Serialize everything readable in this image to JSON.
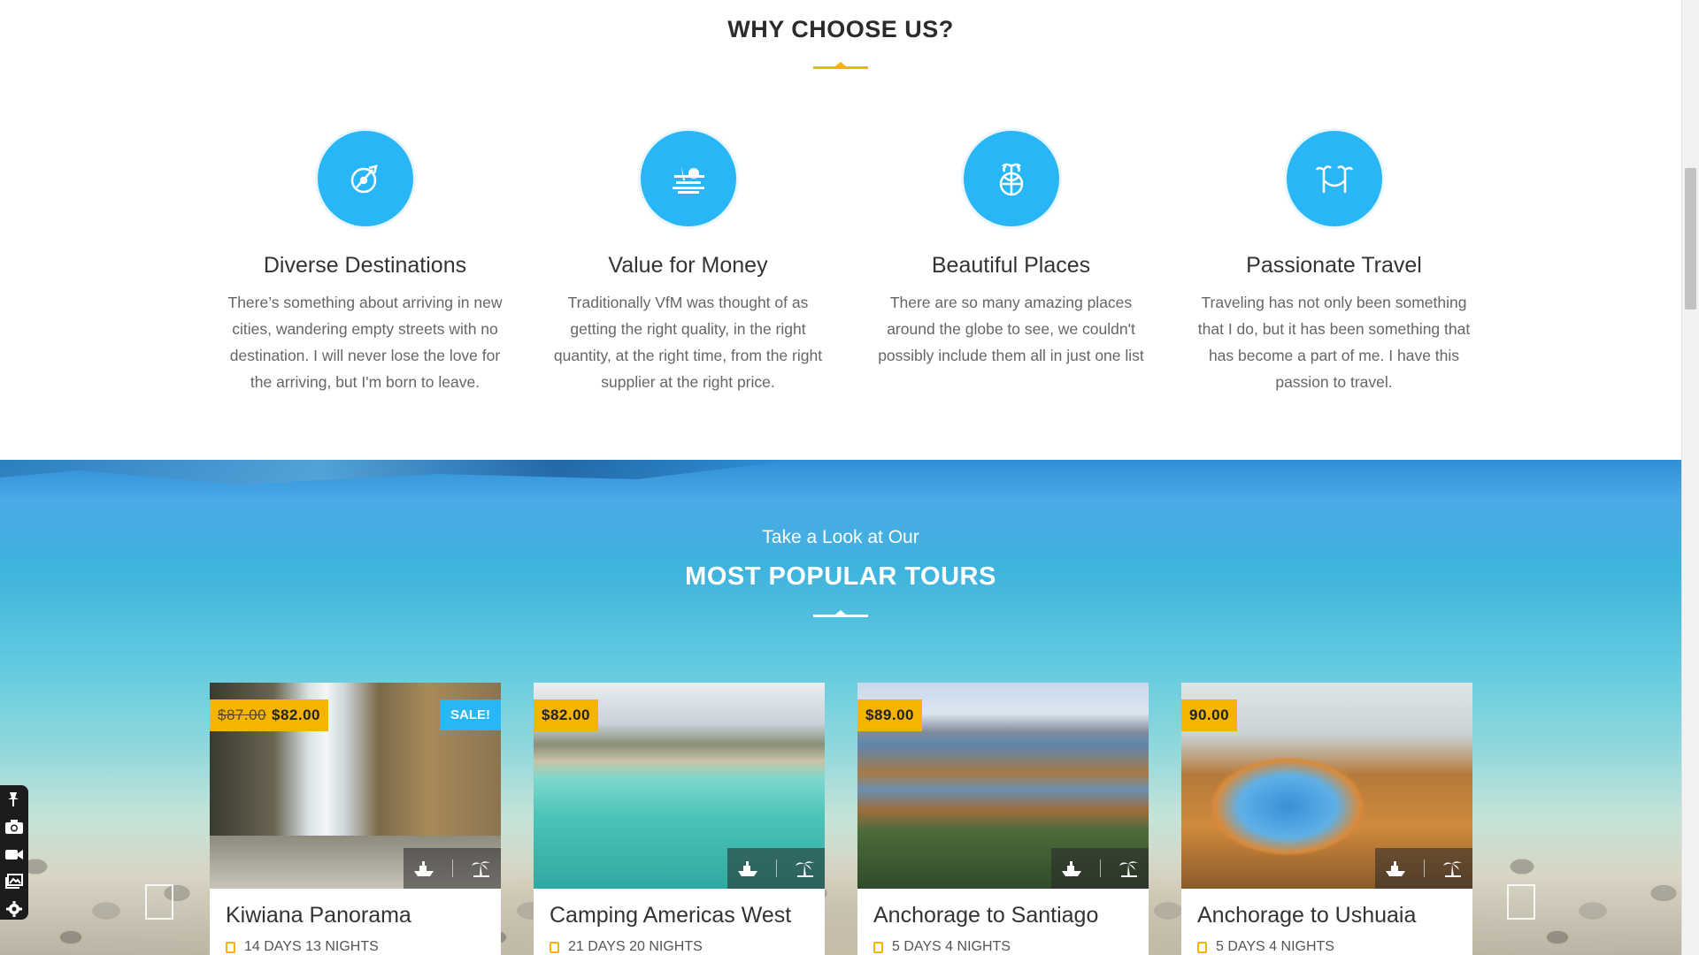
{
  "why": {
    "title": "WHY CHOOSE US?",
    "features": [
      {
        "icon": "compass-icon",
        "title": "Diverse Destinations",
        "text": "There’s something about arriving in new cities, wandering empty streets with no destination. I will never lose the love for the arriving, but I'm born to leave."
      },
      {
        "icon": "beach-sunset-icon",
        "title": "Value for Money",
        "text": "Traditionally VfM was thought of as getting the right quality, in the right quantity, at the right time, from the right supplier at the right price."
      },
      {
        "icon": "globe-palm-icon",
        "title": "Beautiful Places",
        "text": "There are so many amazing places around the globe to see, we couldn't possibly include them all in just one list"
      },
      {
        "icon": "hammock-icon",
        "title": "Passionate Travel",
        "text": "Traveling has not only been something that I do, but it has been something that has become a part of me. I have this passion to travel."
      }
    ]
  },
  "tours": {
    "subtitle": "Take a Look at Our",
    "title": "MOST POPULAR TOURS",
    "cards": [
      {
        "name": "Kiwiana Panorama",
        "old_price": "$87.00",
        "price": "$82.00",
        "sale": "SALE!",
        "duration": "14 DAYS 13 NIGHTS"
      },
      {
        "name": "Camping Americas West",
        "price": "$82.00",
        "duration": "21 DAYS 20 NIGHTS"
      },
      {
        "name": "Anchorage to Santiago",
        "price": "$89.00",
        "duration": "5 DAYS 4 NIGHTS"
      },
      {
        "name": "Anchorage to Ushuaia",
        "price": "90.00",
        "duration": "5 DAYS 4 NIGHTS"
      }
    ]
  },
  "colors": {
    "accent": "#f4b400",
    "brand_blue": "#29b6f6"
  }
}
